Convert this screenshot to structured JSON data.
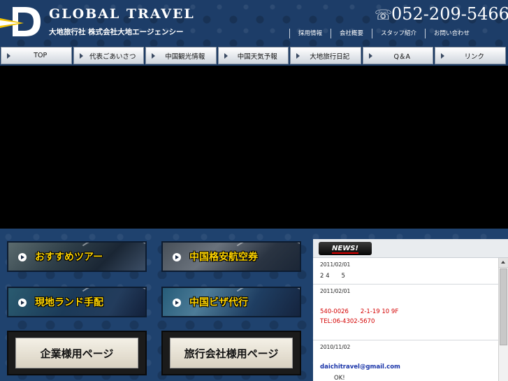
{
  "header": {
    "brand_name": "GLOBAL  TRAVEL",
    "brand_sub": "大地旅行社 株式会社大地エージェンシー",
    "phone": "052-209-5466",
    "util_links": [
      "採用情報",
      "会社概要",
      "スタッフ紹介",
      "お問い合わせ"
    ]
  },
  "nav": {
    "items": [
      "TOP",
      "代表ごあいさつ",
      "中国観光情報",
      "中国天気予報",
      "大地旅行日記",
      "Q＆A",
      "リンク"
    ]
  },
  "banners": {
    "tour": "おすすめツアー",
    "air": "中国格安航空券",
    "land": "現地ランド手配",
    "visa": "中国ビザ代行",
    "corp_recruit": "企業様用ページ",
    "agency_recruit": "旅行会社様用ページ"
  },
  "news": {
    "badge": "NEWS!",
    "entries": [
      {
        "date": "2011/02/01",
        "line1": "2 4　　5"
      },
      {
        "date": "2011/02/01",
        "line1": "540-0026　　2-1-19  10   9F",
        "line2": "TEL:06-4302-5670"
      },
      {
        "date": "2010/11/02",
        "line1": "daichitravel@gmail.com",
        "line2": "OK!"
      }
    ]
  },
  "colors": {
    "header_bg": "#1d3d68",
    "banner_text": "#ffd400",
    "news_red": "#d40000",
    "news_link": "#1833a8"
  },
  "icons": {
    "phone": "telephone-icon",
    "logo": "d-logo-mark"
  }
}
